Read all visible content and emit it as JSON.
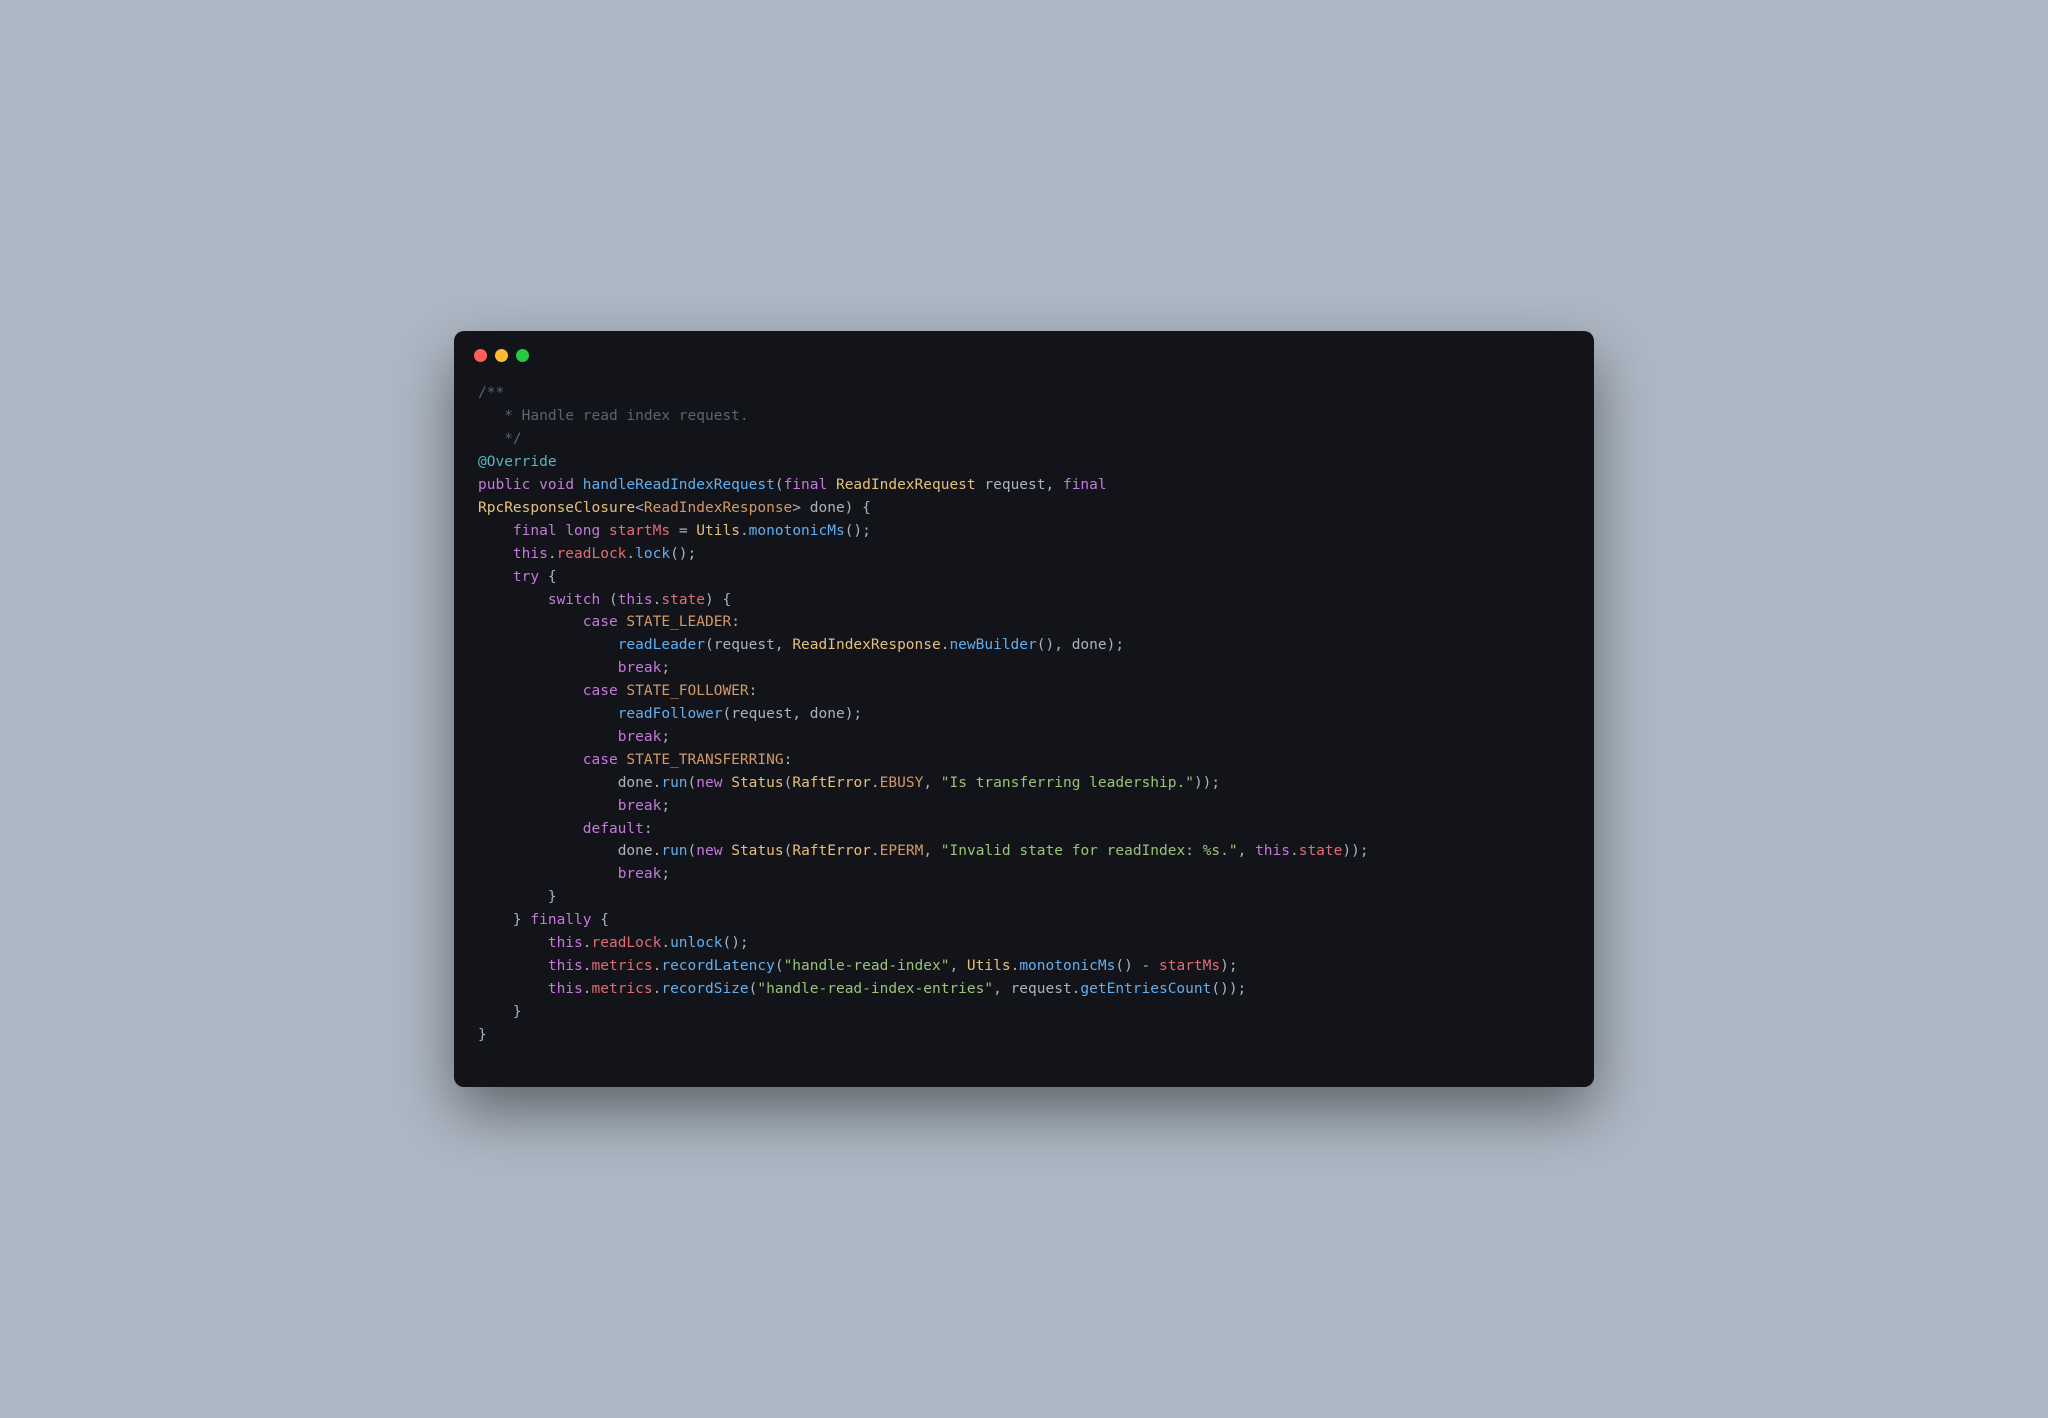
{
  "window": {
    "kind": "macos-terminal"
  },
  "code": {
    "comment_open": "/**",
    "comment_body": "   * Handle read index request.",
    "comment_close": "   */",
    "annotation": "@Override",
    "kw_public": "public",
    "kw_void": "void",
    "method_name": "handleReadIndexRequest",
    "kw_final": "final",
    "type_ReadIndexRequest": "ReadIndexRequest",
    "param_request": "request",
    "type_RpcResponseClosure": "RpcResponseClosure",
    "type_ReadIndexResponse": "ReadIndexResponse",
    "param_done": "done",
    "kw_long": "long",
    "var_startMs": "startMs",
    "type_Utils": "Utils",
    "method_monotonicMs": "monotonicMs",
    "kw_this": "this",
    "field_readLock": "readLock",
    "method_lock": "lock",
    "kw_try": "try",
    "kw_switch": "switch",
    "field_state": "state",
    "kw_case": "case",
    "const_STATE_LEADER": "STATE_LEADER",
    "method_readLeader": "readLeader",
    "method_newBuilder": "newBuilder",
    "kw_break": "break",
    "const_STATE_FOLLOWER": "STATE_FOLLOWER",
    "method_readFollower": "readFollower",
    "const_STATE_TRANSFERRING": "STATE_TRANSFERRING",
    "method_run": "run",
    "kw_new": "new",
    "type_Status": "Status",
    "type_RaftError": "RaftError",
    "const_EBUSY": "EBUSY",
    "str_transferring": "\"Is transferring leadership.\"",
    "kw_default": "default",
    "const_EPERM": "EPERM",
    "str_invalid_state": "\"Invalid state for readIndex: %s.\"",
    "kw_finally": "finally",
    "method_unlock": "unlock",
    "field_metrics": "metrics",
    "method_recordLatency": "recordLatency",
    "str_handle_read_index": "\"handle-read-index\"",
    "method_recordSize": "recordSize",
    "str_handle_entries": "\"handle-read-index-entries\"",
    "method_getEntriesCount": "getEntriesCount"
  }
}
